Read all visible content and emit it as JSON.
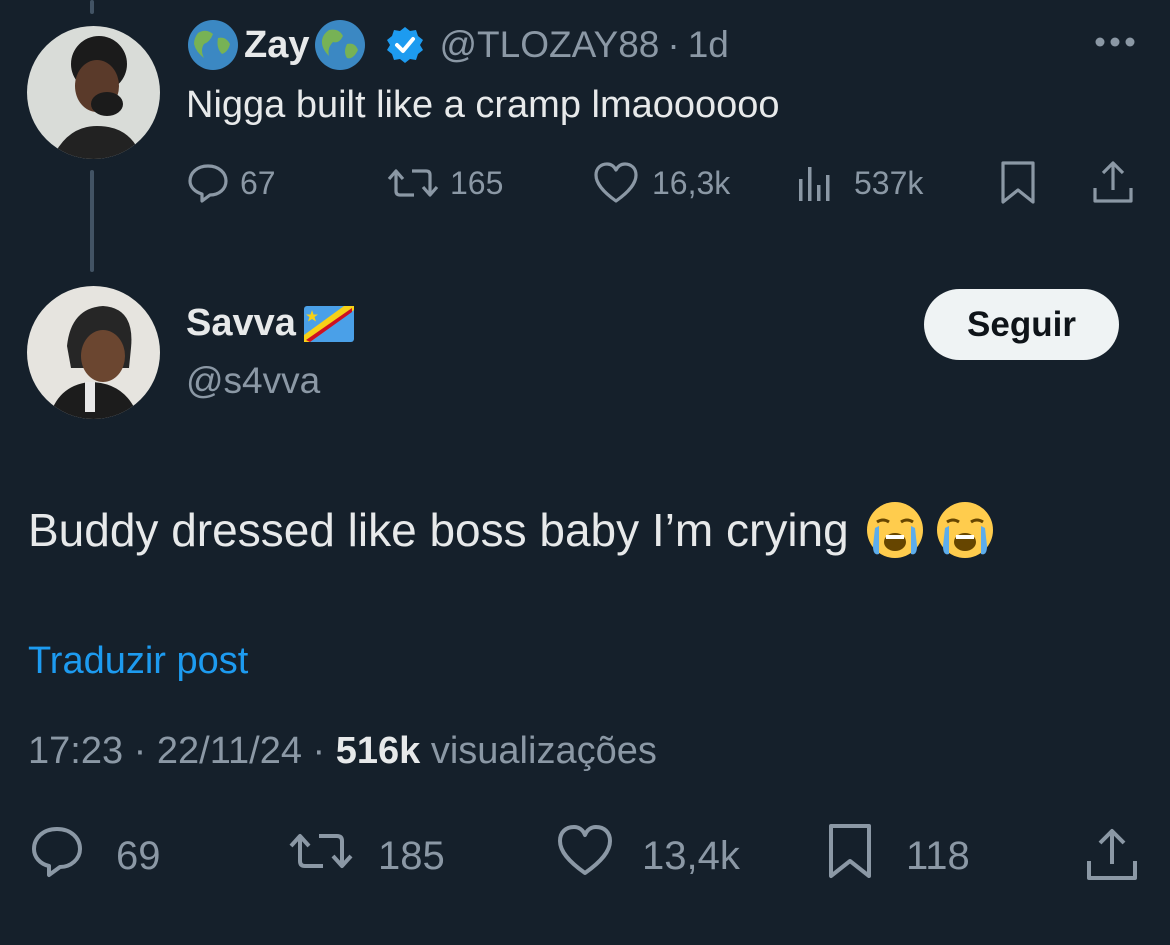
{
  "quoted_tweet": {
    "display_name": "Zay",
    "handle": "@TLOZAY88",
    "separator": "·",
    "time": "1d",
    "text": "Nigga built like a cramp lmaoooooo",
    "stats": {
      "replies": "67",
      "reposts": "165",
      "likes": "16,3k",
      "views": "537k"
    }
  },
  "reply_tweet": {
    "display_name": "Savva",
    "handle": "@s4vva",
    "follow_label": "Seguir",
    "text": "Buddy dressed like boss baby I’m crying",
    "translate_label": "Traduzir post",
    "timestamp": "17:23 · 22/11/24 · ",
    "views_count": "516k",
    "views_label": "visualizações",
    "stats": {
      "replies": "69",
      "reposts": "185",
      "likes": "13,4k",
      "bookmarks": "118"
    }
  },
  "colors": {
    "background": "#15202b",
    "text": "#e7e9ea",
    "secondary": "#8b98a5",
    "link": "#1d9bf0",
    "verified": "#1d9bf0"
  }
}
